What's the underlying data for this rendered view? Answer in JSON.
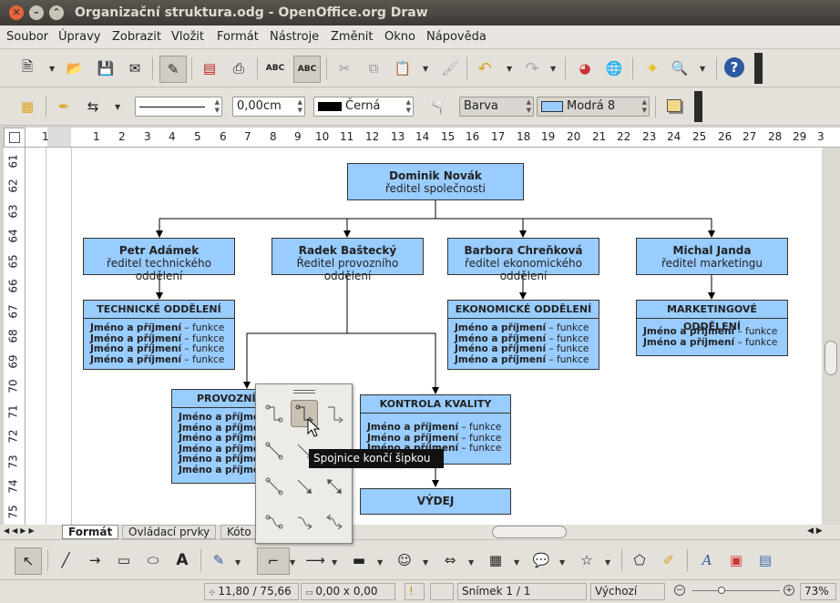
{
  "window": {
    "title": "Organizační struktura.odg - OpenOffice.org Draw"
  },
  "menu": [
    "Soubor",
    "Úpravy",
    "Zobrazit",
    "Vložit",
    "Formát",
    "Nástroje",
    "Změnit",
    "Okno",
    "Nápověda"
  ],
  "line_toolbar": {
    "line_width": "0,00cm",
    "line_color": "Černá",
    "area_style": "Barva",
    "area_color": "Modrá 8",
    "line_color_hex": "#000000",
    "area_color_hex": "#99ccff"
  },
  "ruler_h": [
    "1",
    "1",
    "2",
    "3",
    "4",
    "5",
    "6",
    "7",
    "8",
    "9",
    "10",
    "11",
    "12",
    "13",
    "14",
    "15",
    "16",
    "17",
    "18",
    "19",
    "20",
    "21",
    "22",
    "23",
    "24",
    "25",
    "26",
    "27",
    "28",
    "29",
    "3"
  ],
  "ruler_v": [
    "61",
    "62",
    "63",
    "64",
    "65",
    "66",
    "67",
    "68",
    "69",
    "70",
    "71",
    "72",
    "73",
    "74",
    "75"
  ],
  "chart": {
    "ceo": {
      "name": "Dominik Novák",
      "role": "ředitel společnosti"
    },
    "directors": [
      {
        "name": "Petr Adámek",
        "role": "ředitel technického oddělení"
      },
      {
        "name": "Radek Baštecký",
        "role": "Ředitel provozního oddělení"
      },
      {
        "name": "Barbora Chreňková",
        "role": "ředitel ekonomického oddělení"
      },
      {
        "name": "Michal Janda",
        "role": "ředitel marketingu"
      }
    ],
    "row_name": "Jméno a příjmení",
    "row_fn": " – funkce",
    "departments": {
      "tech": "TECHNICKÉ ODDĚLENÍ",
      "econ": "EKONOMICKÉ ODDĚLENÍ",
      "mkt": "MARKETINGOVÉ ODDĚLENÍ",
      "prov": "PROVOZNÍ O",
      "quality": "KONTROLA KVALITY",
      "output": "VÝDEJ"
    }
  },
  "tabs": [
    "Formát",
    "Ovládací prvky",
    "Kóto"
  ],
  "tooltip": "Spojnice končí šipkou",
  "status": {
    "position": "11,80 / 75,66",
    "size": "0,00 x 0,00",
    "slide": "Snímek 1 / 1",
    "layout": "Výchozí",
    "zoom": "73%"
  }
}
